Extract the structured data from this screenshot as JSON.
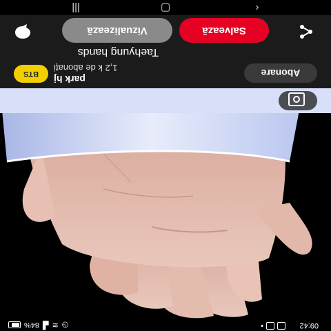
{
  "status_bar": {
    "time": "09:42",
    "battery": "84%",
    "left_icons": [
      "whatsapp-icon",
      "gallery-icon",
      "notification-dot-icon"
    ],
    "right_icons": [
      "alarm-icon",
      "wifi-icon",
      "signal-icon",
      "battery-icon"
    ]
  },
  "pin": {
    "title": "Taehyung hands",
    "image_description_icon": "hands-photo"
  },
  "account": {
    "name": "park hj",
    "subscribers": "1,2 k de abonați",
    "avatar_text": "BTS",
    "subscribe_label": "Abonare"
  },
  "actions": {
    "visualize_label": "Vizualizează",
    "save_label": "Salvează"
  },
  "colors": {
    "save": "#e60023",
    "visualize": "#8a8a8a",
    "avatar": "#f2d000",
    "panel": "#1b1b1b"
  },
  "navigation": {
    "back_icon": "chevron-left-icon",
    "menu_icon": "more-dots-icon",
    "lens_icon": "visual-search-icon"
  }
}
